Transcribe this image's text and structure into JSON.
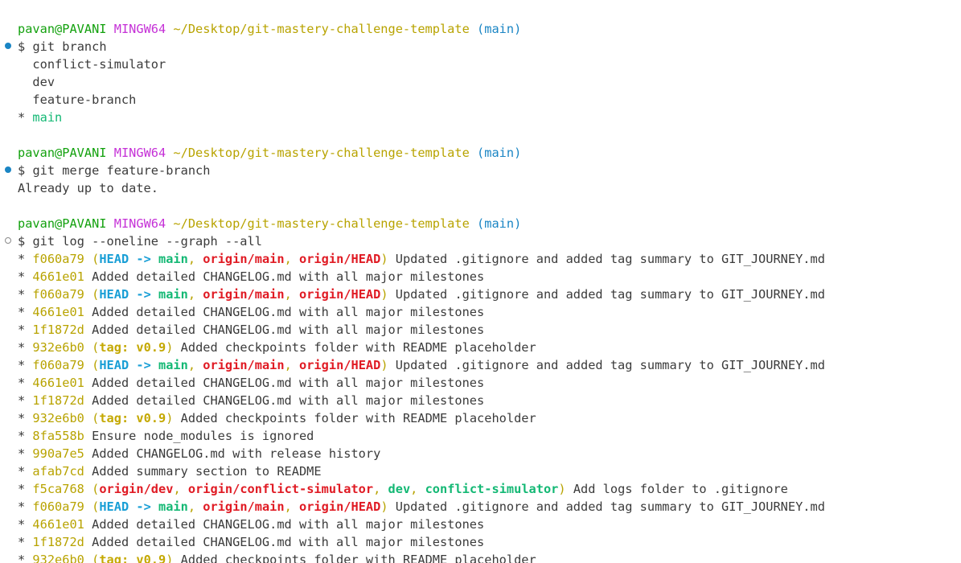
{
  "prompt": {
    "user": "pavan@PAVANI",
    "system": "MINGW64",
    "path": "~/Desktop/git-mastery-challenge-template",
    "branch": "(main)",
    "symbol": "$"
  },
  "colors": {
    "prompt_user": "#13a10e",
    "prompt_system": "#c531d7",
    "prompt_path": "#b8a300",
    "prompt_branch": "#1a85c4",
    "commit_hash": "#b8a300",
    "ref_head": "#1a9fd6",
    "ref_local_branch": "#13b874",
    "ref_remote": "#e01b24",
    "ref_tag": "#c4a800",
    "command_marker_success": "#1a85c4"
  },
  "blocks": [
    {
      "command": "git branch",
      "marker": "filled",
      "output": {
        "branches": [
          {
            "prefix": "  ",
            "name": "conflict-simulator",
            "current": false
          },
          {
            "prefix": "  ",
            "name": "dev",
            "current": false
          },
          {
            "prefix": "  ",
            "name": "feature-branch",
            "current": false
          },
          {
            "prefix": "* ",
            "name": "main",
            "current": true
          }
        ]
      }
    },
    {
      "command": "git merge feature-branch",
      "marker": "filled",
      "output": {
        "text": "Already up to date."
      }
    },
    {
      "command": "git log --oneline --graph --all",
      "marker": "hollow",
      "output": {
        "commits": [
          {
            "graph": "* ",
            "hash": "f060a79",
            "refs": [
              "HEAD -> main",
              "origin/main",
              "origin/HEAD"
            ],
            "message": "Updated .gitignore and added tag summary to GIT_JOURNEY.md"
          },
          {
            "graph": "* ",
            "hash": "4661e01",
            "refs": [],
            "message": "Added detailed CHANGELOG.md with all major milestones"
          },
          {
            "graph": "* ",
            "hash": "f060a79",
            "refs": [
              "HEAD -> main",
              "origin/main",
              "origin/HEAD"
            ],
            "message": "Updated .gitignore and added tag summary to GIT_JOURNEY.md"
          },
          {
            "graph": "* ",
            "hash": "4661e01",
            "refs": [],
            "message": "Added detailed CHANGELOG.md with all major milestones"
          },
          {
            "graph": "* ",
            "hash": "1f1872d",
            "refs": [],
            "message": "Added detailed CHANGELOG.md with all major milestones"
          },
          {
            "graph": "* ",
            "hash": "932e6b0",
            "refs": [
              "tag: v0.9"
            ],
            "message": "Added checkpoints folder with README placeholder"
          },
          {
            "graph": "* ",
            "hash": "f060a79",
            "refs": [
              "HEAD -> main",
              "origin/main",
              "origin/HEAD"
            ],
            "message": "Updated .gitignore and added tag summary to GIT_JOURNEY.md"
          },
          {
            "graph": "* ",
            "hash": "4661e01",
            "refs": [],
            "message": "Added detailed CHANGELOG.md with all major milestones"
          },
          {
            "graph": "* ",
            "hash": "1f1872d",
            "refs": [],
            "message": "Added detailed CHANGELOG.md with all major milestones"
          },
          {
            "graph": "* ",
            "hash": "932e6b0",
            "refs": [
              "tag: v0.9"
            ],
            "message": "Added checkpoints folder with README placeholder"
          },
          {
            "graph": "* ",
            "hash": "8fa558b",
            "refs": [],
            "message": "Ensure node_modules is ignored"
          },
          {
            "graph": "* ",
            "hash": "990a7e5",
            "refs": [],
            "message": "Added CHANGELOG.md with release history"
          },
          {
            "graph": "* ",
            "hash": "afab7cd",
            "refs": [],
            "message": "Added summary section to README"
          },
          {
            "graph": "* ",
            "hash": "f5ca768",
            "refs": [
              "origin/dev",
              "origin/conflict-simulator",
              "dev",
              "conflict-simulator"
            ],
            "message": "Add logs folder to .gitignore"
          },
          {
            "graph": "* ",
            "hash": "f060a79",
            "refs": [
              "HEAD -> main",
              "origin/main",
              "origin/HEAD"
            ],
            "message": "Updated .gitignore and added tag summary to GIT_JOURNEY.md"
          },
          {
            "graph": "* ",
            "hash": "4661e01",
            "refs": [],
            "message": "Added detailed CHANGELOG.md with all major milestones"
          },
          {
            "graph": "* ",
            "hash": "1f1872d",
            "refs": [],
            "message": "Added detailed CHANGELOG.md with all major milestones"
          },
          {
            "graph": "* ",
            "hash": "932e6b0",
            "refs": [
              "tag: v0.9"
            ],
            "message": "Added checkpoints folder with README placeholder"
          }
        ]
      }
    }
  ]
}
